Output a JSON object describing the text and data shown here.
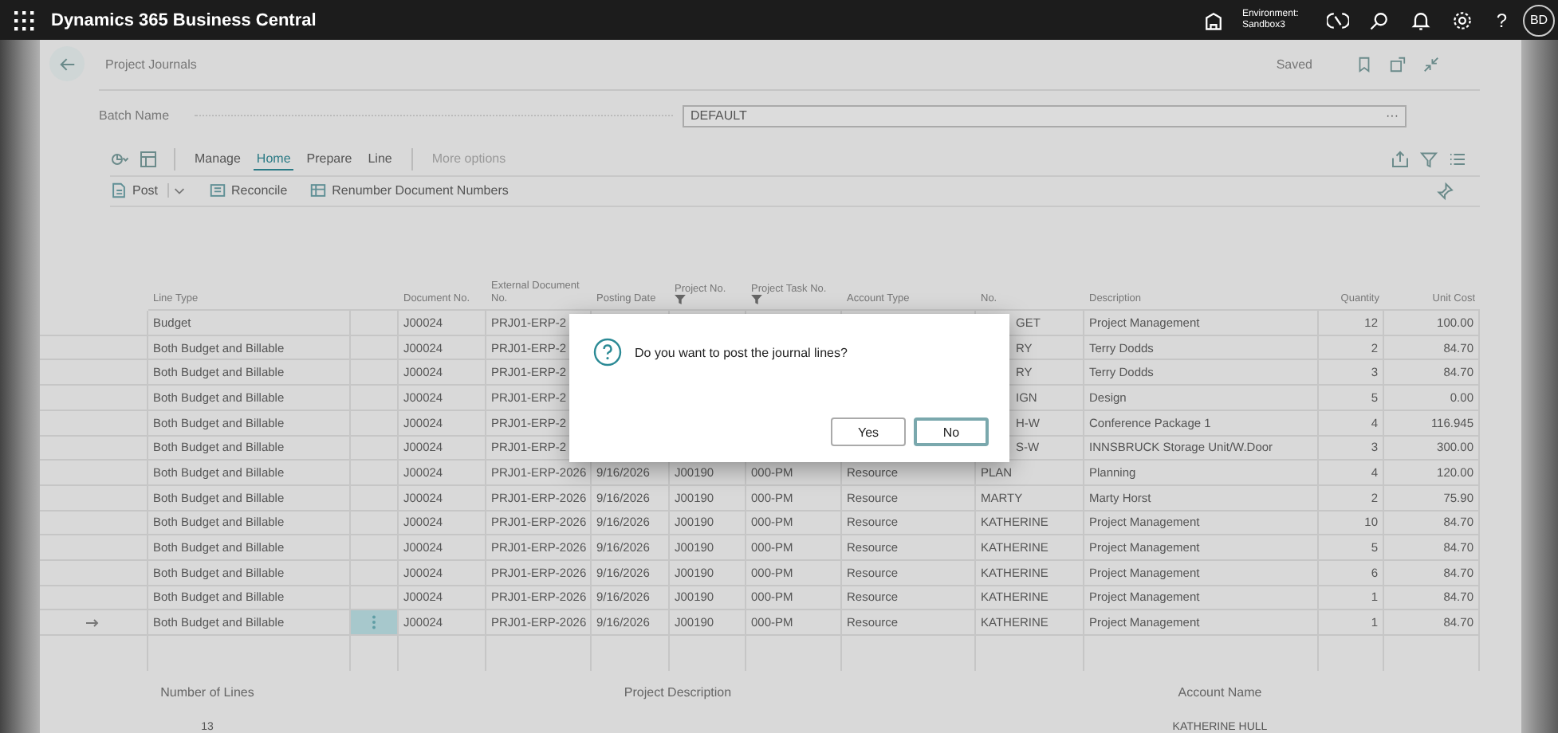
{
  "top_bar": {
    "title": "Dynamics 365 Business Central",
    "environment_label": "Environment:",
    "environment_name": "Sandbox3",
    "help": "?",
    "avatar": "BD"
  },
  "page": {
    "title": "Project Journals",
    "saved": "Saved"
  },
  "batch": {
    "label": "Batch Name",
    "value": "DEFAULT",
    "lookup": "···"
  },
  "action_tabs": [
    {
      "label": "Manage",
      "selected": false
    },
    {
      "label": "Home",
      "selected": true
    },
    {
      "label": "Prepare",
      "selected": false
    },
    {
      "label": "Line",
      "selected": false
    }
  ],
  "more_options": "More options",
  "actions": [
    {
      "label": "Post",
      "kind": "post"
    },
    {
      "label": "Reconcile",
      "kind": "reconcile"
    },
    {
      "label": "Renumber Document Numbers",
      "kind": "renumber"
    }
  ],
  "table": {
    "columns": [
      {
        "label": "Line Type",
        "filtered": false
      },
      {
        "label": "Document No.",
        "filtered": false
      },
      {
        "label": "External Document No.",
        "filtered": false
      },
      {
        "label": "Posting Date",
        "filtered": false
      },
      {
        "label": "Project No.",
        "filtered": true
      },
      {
        "label": "Project Task No.",
        "filtered": true
      },
      {
        "label": "Account Type",
        "filtered": false
      },
      {
        "label": "No.",
        "filtered": false
      },
      {
        "label": "Description",
        "filtered": false
      },
      {
        "label": "Quantity",
        "filtered": false
      },
      {
        "label": "Unit Cost",
        "filtered": false
      }
    ],
    "rows": [
      {
        "selected": false,
        "cells": [
          "Budget",
          "J00024",
          "PRJ01-ERP-2",
          null,
          null,
          null,
          null,
          "GET",
          "Project Management",
          "12",
          "100.00"
        ]
      },
      {
        "selected": false,
        "cells": [
          "Both Budget and Billable",
          "J00024",
          "PRJ01-ERP-2",
          null,
          null,
          null,
          null,
          "RY",
          "Terry Dodds",
          "2",
          "84.70"
        ]
      },
      {
        "selected": false,
        "cells": [
          "Both Budget and Billable",
          "J00024",
          "PRJ01-ERP-2",
          null,
          null,
          null,
          null,
          "RY",
          "Terry Dodds",
          "3",
          "84.70"
        ]
      },
      {
        "selected": false,
        "cells": [
          "Both Budget and Billable",
          "J00024",
          "PRJ01-ERP-2",
          null,
          null,
          null,
          null,
          "IGN",
          "Design",
          "5",
          "0.00"
        ]
      },
      {
        "selected": false,
        "cells": [
          "Both Budget and Billable",
          "J00024",
          "PRJ01-ERP-2",
          null,
          null,
          null,
          null,
          "H-W",
          "Conference Package 1",
          "4",
          "116.945"
        ]
      },
      {
        "selected": false,
        "cells": [
          "Both Budget and Billable",
          "J00024",
          "PRJ01-ERP-2",
          null,
          null,
          null,
          null,
          "S-W",
          "INNSBRUCK Storage Unit/W.Door",
          "3",
          "300.00"
        ]
      },
      {
        "selected": false,
        "cells": [
          "Both Budget and Billable",
          "J00024",
          "PRJ01-ERP-2026",
          "9/16/2026",
          "J00190",
          "000-PM",
          "Resource",
          "PLAN",
          "Planning",
          "4",
          "120.00"
        ]
      },
      {
        "selected": false,
        "cells": [
          "Both Budget and Billable",
          "J00024",
          "PRJ01-ERP-2026",
          "9/16/2026",
          "J00190",
          "000-PM",
          "Resource",
          "MARTY",
          "Marty Horst",
          "2",
          "75.90"
        ]
      },
      {
        "selected": false,
        "cells": [
          "Both Budget and Billable",
          "J00024",
          "PRJ01-ERP-2026",
          "9/16/2026",
          "J00190",
          "000-PM",
          "Resource",
          "KATHERINE",
          "Project Management",
          "10",
          "84.70"
        ]
      },
      {
        "selected": false,
        "cells": [
          "Both Budget and Billable",
          "J00024",
          "PRJ01-ERP-2026",
          "9/16/2026",
          "J00190",
          "000-PM",
          "Resource",
          "KATHERINE",
          "Project Management",
          "5",
          "84.70"
        ]
      },
      {
        "selected": false,
        "cells": [
          "Both Budget and Billable",
          "J00024",
          "PRJ01-ERP-2026",
          "9/16/2026",
          "J00190",
          "000-PM",
          "Resource",
          "KATHERINE",
          "Project Management",
          "6",
          "84.70"
        ]
      },
      {
        "selected": false,
        "cells": [
          "Both Budget and Billable",
          "J00024",
          "PRJ01-ERP-2026",
          "9/16/2026",
          "J00190",
          "000-PM",
          "Resource",
          "KATHERINE",
          "Project Management",
          "1",
          "84.70"
        ]
      },
      {
        "selected": true,
        "cells": [
          "Both Budget and Billable",
          "J00024",
          "PRJ01-ERP-2026",
          "9/16/2026",
          "J00190",
          "000-PM",
          "Resource",
          "KATHERINE",
          "Project Management",
          "1",
          "84.70"
        ]
      }
    ]
  },
  "footer": [
    {
      "label": "Number of Lines",
      "value": "13"
    },
    {
      "label": "Project Description"
    },
    {
      "label": "Account Name",
      "value": "KATHERINE HULL"
    }
  ],
  "dialog": {
    "message": "Do you want to post the journal lines?",
    "buttons": [
      {
        "label": "Yes",
        "selected": false
      },
      {
        "label": "No",
        "selected": true
      }
    ]
  }
}
